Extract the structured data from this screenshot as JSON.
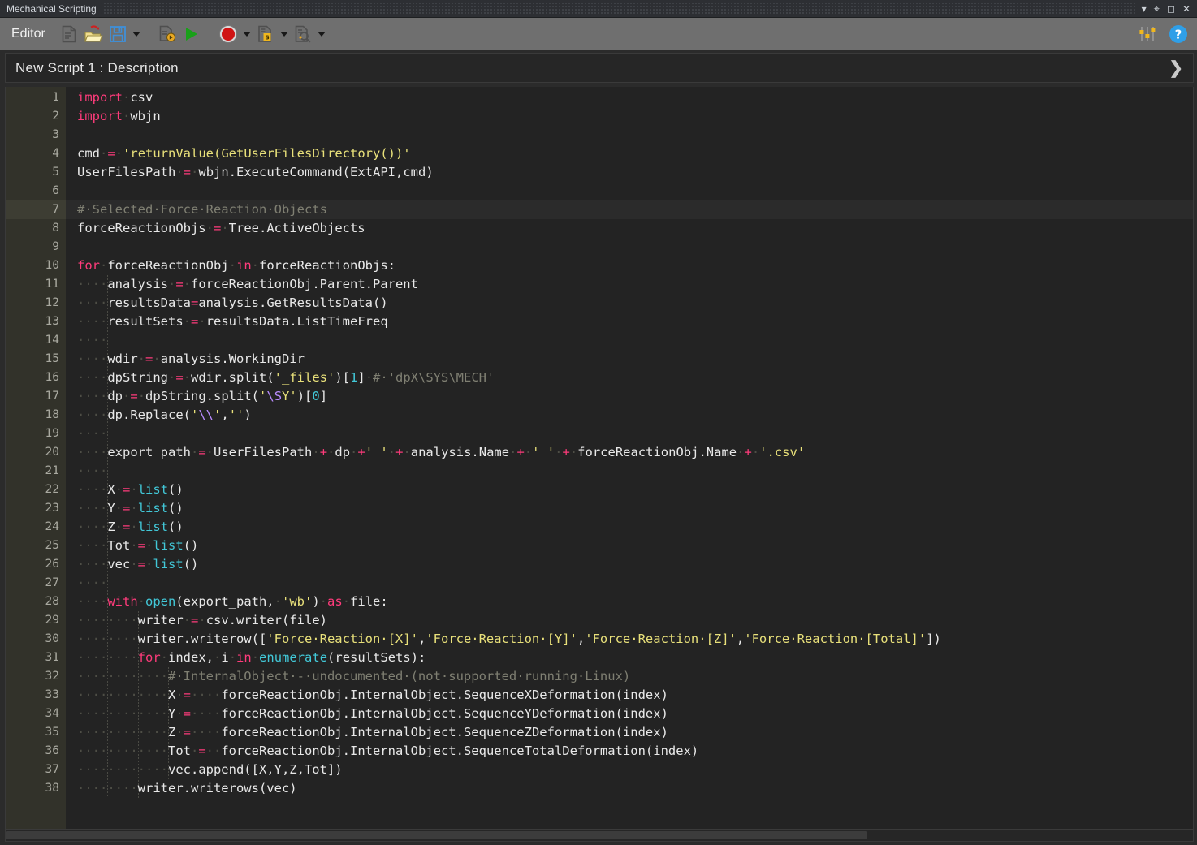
{
  "window": {
    "title": "Mechanical Scripting",
    "buttons": [
      {
        "name": "titlebar-dropdown-icon",
        "glyph": "▾"
      },
      {
        "name": "pin-icon",
        "glyph": "⇟"
      },
      {
        "name": "maximize-icon",
        "glyph": "◻"
      },
      {
        "name": "close-icon",
        "glyph": "✕"
      }
    ]
  },
  "toolbar": {
    "label": "Editor",
    "items": [
      {
        "name": "new-script-button",
        "icon": "new-file-icon",
        "tooltip": "New Script"
      },
      {
        "name": "open-script-button",
        "icon": "open-folder-icon",
        "tooltip": "Open Script"
      },
      {
        "name": "save-script-button",
        "icon": "save-disk-icon",
        "tooltip": "Save Script"
      },
      {
        "name": "save-dropdown-button",
        "icon": "chevron-down-icon",
        "tooltip": "Save options"
      },
      {
        "name": "debug-run-button",
        "icon": "debug-script-icon",
        "tooltip": "Debug"
      },
      {
        "name": "run-script-button",
        "icon": "play-triangle-icon",
        "tooltip": "Run Script"
      },
      {
        "name": "record-button",
        "icon": "record-circle-icon",
        "tooltip": "Record"
      },
      {
        "name": "record-dropdown-button",
        "icon": "chevron-down-icon",
        "tooltip": "Record options"
      },
      {
        "name": "snippet-button",
        "icon": "snippet-s-icon",
        "tooltip": "Snippets"
      },
      {
        "name": "snippet-dropdown-button",
        "icon": "chevron-down-icon",
        "tooltip": "Snippet options"
      },
      {
        "name": "find-script-button",
        "icon": "search-document-icon",
        "tooltip": "Find"
      },
      {
        "name": "find-dropdown-button",
        "icon": "chevron-down-icon",
        "tooltip": "Find options"
      }
    ],
    "right_items": [
      {
        "name": "settings-sliders-button",
        "icon": "sliders-icon"
      },
      {
        "name": "help-button",
        "icon": "help-circle-icon"
      }
    ]
  },
  "script_header": {
    "name": "New Script 1  : Description",
    "expand_glyph": "❯"
  },
  "editor": {
    "first_line": 1,
    "total_lines": 38,
    "highlighted_line": 7,
    "fold_lines": [
      10,
      28,
      31
    ],
    "lines": [
      {
        "n": 1,
        "tokens": [
          [
            "kw",
            "import"
          ],
          [
            "ws",
            "·"
          ],
          [
            "pl",
            "csv"
          ]
        ]
      },
      {
        "n": 2,
        "tokens": [
          [
            "kw",
            "import"
          ],
          [
            "ws",
            "·"
          ],
          [
            "pl",
            "wbjn"
          ]
        ]
      },
      {
        "n": 3,
        "tokens": []
      },
      {
        "n": 4,
        "tokens": [
          [
            "pl",
            "cmd"
          ],
          [
            "ws",
            "·"
          ],
          [
            "op",
            "="
          ],
          [
            "ws",
            "·"
          ],
          [
            "str",
            "'returnValue(GetUserFilesDirectory())'"
          ]
        ]
      },
      {
        "n": 5,
        "tokens": [
          [
            "pl",
            "UserFilesPath"
          ],
          [
            "ws",
            "·"
          ],
          [
            "op",
            "="
          ],
          [
            "ws",
            "·"
          ],
          [
            "pl",
            "wbjn.ExecuteCommand(ExtAPI,cmd)"
          ]
        ]
      },
      {
        "n": 6,
        "tokens": []
      },
      {
        "n": 7,
        "tokens": [
          [
            "cmt",
            "#·Selected·Force·Reaction·Objects"
          ]
        ]
      },
      {
        "n": 8,
        "tokens": [
          [
            "pl",
            "forceReactionObjs"
          ],
          [
            "ws",
            "·"
          ],
          [
            "op",
            "="
          ],
          [
            "ws",
            "·"
          ],
          [
            "pl",
            "Tree.ActiveObjects"
          ]
        ]
      },
      {
        "n": 9,
        "tokens": []
      },
      {
        "n": 10,
        "tokens": [
          [
            "kw",
            "for"
          ],
          [
            "ws",
            "·"
          ],
          [
            "pl",
            "forceReactionObj"
          ],
          [
            "ws",
            "·"
          ],
          [
            "kw",
            "in"
          ],
          [
            "ws",
            "·"
          ],
          [
            "pl",
            "forceReactionObjs:"
          ]
        ]
      },
      {
        "n": 11,
        "tokens": [
          [
            "ws",
            "····"
          ],
          [
            "pl",
            "analysis"
          ],
          [
            "ws",
            "·"
          ],
          [
            "op",
            "="
          ],
          [
            "ws",
            "·"
          ],
          [
            "pl",
            "forceReactionObj.Parent.Parent"
          ]
        ]
      },
      {
        "n": 12,
        "tokens": [
          [
            "ws",
            "····"
          ],
          [
            "pl",
            "resultsData"
          ],
          [
            "op",
            "="
          ],
          [
            "pl",
            "analysis.GetResultsData()"
          ]
        ]
      },
      {
        "n": 13,
        "tokens": [
          [
            "ws",
            "····"
          ],
          [
            "pl",
            "resultSets"
          ],
          [
            "ws",
            "·"
          ],
          [
            "op",
            "="
          ],
          [
            "ws",
            "·"
          ],
          [
            "pl",
            "resultsData.ListTimeFreq"
          ]
        ]
      },
      {
        "n": 14,
        "tokens": [
          [
            "ws",
            "····"
          ]
        ]
      },
      {
        "n": 15,
        "tokens": [
          [
            "ws",
            "····"
          ],
          [
            "pl",
            "wdir"
          ],
          [
            "ws",
            "·"
          ],
          [
            "op",
            "="
          ],
          [
            "ws",
            "·"
          ],
          [
            "pl",
            "analysis.WorkingDir"
          ]
        ]
      },
      {
        "n": 16,
        "tokens": [
          [
            "ws",
            "····"
          ],
          [
            "pl",
            "dpString"
          ],
          [
            "ws",
            "·"
          ],
          [
            "op",
            "="
          ],
          [
            "ws",
            "·"
          ],
          [
            "pl",
            "wdir.split("
          ],
          [
            "str",
            "'_files'"
          ],
          [
            "pl",
            ")["
          ],
          [
            "num",
            "1"
          ],
          [
            "pl",
            "]"
          ],
          [
            "ws",
            "·"
          ],
          [
            "cmt",
            "#·'dpX\\SYS\\MECH'"
          ]
        ]
      },
      {
        "n": 17,
        "tokens": [
          [
            "ws",
            "····"
          ],
          [
            "pl",
            "dp"
          ],
          [
            "ws",
            "·"
          ],
          [
            "op",
            "="
          ],
          [
            "ws",
            "·"
          ],
          [
            "pl",
            "dpString.split("
          ],
          [
            "str",
            "'"
          ],
          [
            "esc",
            "\\S"
          ],
          [
            "str",
            "Y'"
          ],
          [
            "pl",
            ")["
          ],
          [
            "num",
            "0"
          ],
          [
            "pl",
            "]"
          ]
        ]
      },
      {
        "n": 18,
        "tokens": [
          [
            "ws",
            "····"
          ],
          [
            "pl",
            "dp.Replace("
          ],
          [
            "str",
            "'"
          ],
          [
            "esc",
            "\\\\"
          ],
          [
            "str",
            "'"
          ],
          [
            "pl",
            ","
          ],
          [
            "str",
            "''"
          ],
          [
            "pl",
            ")"
          ]
        ]
      },
      {
        "n": 19,
        "tokens": [
          [
            "ws",
            "····"
          ]
        ]
      },
      {
        "n": 20,
        "tokens": [
          [
            "ws",
            "····"
          ],
          [
            "pl",
            "export_path"
          ],
          [
            "ws",
            "·"
          ],
          [
            "op",
            "="
          ],
          [
            "ws",
            "·"
          ],
          [
            "pl",
            "UserFilesPath"
          ],
          [
            "ws",
            "·"
          ],
          [
            "op",
            "+"
          ],
          [
            "ws",
            "·"
          ],
          [
            "pl",
            "dp"
          ],
          [
            "ws",
            "·"
          ],
          [
            "op",
            "+"
          ],
          [
            "str",
            "'_'"
          ],
          [
            "ws",
            "·"
          ],
          [
            "op",
            "+"
          ],
          [
            "ws",
            "·"
          ],
          [
            "pl",
            "analysis.Name"
          ],
          [
            "ws",
            "·"
          ],
          [
            "op",
            "+"
          ],
          [
            "ws",
            "·"
          ],
          [
            "str",
            "'_'"
          ],
          [
            "ws",
            "·"
          ],
          [
            "op",
            "+"
          ],
          [
            "ws",
            "·"
          ],
          [
            "pl",
            "forceReactionObj.Name"
          ],
          [
            "ws",
            "·"
          ],
          [
            "op",
            "+"
          ],
          [
            "ws",
            "·"
          ],
          [
            "str",
            "'.csv'"
          ]
        ]
      },
      {
        "n": 21,
        "tokens": [
          [
            "ws",
            "····"
          ]
        ]
      },
      {
        "n": 22,
        "tokens": [
          [
            "ws",
            "····"
          ],
          [
            "pl",
            "X"
          ],
          [
            "ws",
            "·"
          ],
          [
            "op",
            "="
          ],
          [
            "ws",
            "·"
          ],
          [
            "bi",
            "list"
          ],
          [
            "pl",
            "()"
          ]
        ]
      },
      {
        "n": 23,
        "tokens": [
          [
            "ws",
            "····"
          ],
          [
            "pl",
            "Y"
          ],
          [
            "ws",
            "·"
          ],
          [
            "op",
            "="
          ],
          [
            "ws",
            "·"
          ],
          [
            "bi",
            "list"
          ],
          [
            "pl",
            "()"
          ]
        ]
      },
      {
        "n": 24,
        "tokens": [
          [
            "ws",
            "····"
          ],
          [
            "pl",
            "Z"
          ],
          [
            "ws",
            "·"
          ],
          [
            "op",
            "="
          ],
          [
            "ws",
            "·"
          ],
          [
            "bi",
            "list"
          ],
          [
            "pl",
            "()"
          ]
        ]
      },
      {
        "n": 25,
        "tokens": [
          [
            "ws",
            "····"
          ],
          [
            "pl",
            "Tot"
          ],
          [
            "ws",
            "·"
          ],
          [
            "op",
            "="
          ],
          [
            "ws",
            "·"
          ],
          [
            "bi",
            "list"
          ],
          [
            "pl",
            "()"
          ]
        ]
      },
      {
        "n": 26,
        "tokens": [
          [
            "ws",
            "····"
          ],
          [
            "pl",
            "vec"
          ],
          [
            "ws",
            "·"
          ],
          [
            "op",
            "="
          ],
          [
            "ws",
            "·"
          ],
          [
            "bi",
            "list"
          ],
          [
            "pl",
            "()"
          ]
        ]
      },
      {
        "n": 27,
        "tokens": [
          [
            "ws",
            "····"
          ]
        ]
      },
      {
        "n": 28,
        "tokens": [
          [
            "ws",
            "····"
          ],
          [
            "kw",
            "with"
          ],
          [
            "ws",
            "·"
          ],
          [
            "bi",
            "open"
          ],
          [
            "pl",
            "(export_path,"
          ],
          [
            "ws",
            "·"
          ],
          [
            "str",
            "'wb'"
          ],
          [
            "pl",
            ")"
          ],
          [
            "ws",
            "·"
          ],
          [
            "kw",
            "as"
          ],
          [
            "ws",
            "·"
          ],
          [
            "pl",
            "file:"
          ]
        ]
      },
      {
        "n": 29,
        "tokens": [
          [
            "ws",
            "········"
          ],
          [
            "pl",
            "writer"
          ],
          [
            "ws",
            "·"
          ],
          [
            "op",
            "="
          ],
          [
            "ws",
            "·"
          ],
          [
            "pl",
            "csv.writer(file)"
          ]
        ]
      },
      {
        "n": 30,
        "tokens": [
          [
            "ws",
            "········"
          ],
          [
            "pl",
            "writer.writerow(["
          ],
          [
            "str",
            "'Force·Reaction·[X]'"
          ],
          [
            "pl",
            ","
          ],
          [
            "str",
            "'Force·Reaction·[Y]'"
          ],
          [
            "pl",
            ","
          ],
          [
            "str",
            "'Force·Reaction·[Z]'"
          ],
          [
            "pl",
            ","
          ],
          [
            "str",
            "'Force·Reaction·[Total]'"
          ],
          [
            "pl",
            "])"
          ]
        ]
      },
      {
        "n": 31,
        "tokens": [
          [
            "ws",
            "········"
          ],
          [
            "kw",
            "for"
          ],
          [
            "ws",
            "·"
          ],
          [
            "pl",
            "index,"
          ],
          [
            "ws",
            "·"
          ],
          [
            "pl",
            "i"
          ],
          [
            "ws",
            "·"
          ],
          [
            "kw",
            "in"
          ],
          [
            "ws",
            "·"
          ],
          [
            "bi",
            "enumerate"
          ],
          [
            "pl",
            "(resultSets):"
          ]
        ]
      },
      {
        "n": 32,
        "tokens": [
          [
            "ws",
            "············"
          ],
          [
            "cmt",
            "#·InternalObject·-·undocumented·(not·supported·running·Linux)"
          ]
        ]
      },
      {
        "n": 33,
        "tokens": [
          [
            "ws",
            "············"
          ],
          [
            "pl",
            "X"
          ],
          [
            "ws",
            "·"
          ],
          [
            "op",
            "="
          ],
          [
            "ws",
            "····"
          ],
          [
            "pl",
            "forceReactionObj.InternalObject.SequenceXDeformation(index)"
          ]
        ]
      },
      {
        "n": 34,
        "tokens": [
          [
            "ws",
            "············"
          ],
          [
            "pl",
            "Y"
          ],
          [
            "ws",
            "·"
          ],
          [
            "op",
            "="
          ],
          [
            "ws",
            "····"
          ],
          [
            "pl",
            "forceReactionObj.InternalObject.SequenceYDeformation(index)"
          ]
        ]
      },
      {
        "n": 35,
        "tokens": [
          [
            "ws",
            "············"
          ],
          [
            "pl",
            "Z"
          ],
          [
            "ws",
            "·"
          ],
          [
            "op",
            "="
          ],
          [
            "ws",
            "····"
          ],
          [
            "pl",
            "forceReactionObj.InternalObject.SequenceZDeformation(index)"
          ]
        ]
      },
      {
        "n": 36,
        "tokens": [
          [
            "ws",
            "············"
          ],
          [
            "pl",
            "Tot"
          ],
          [
            "ws",
            "·"
          ],
          [
            "op",
            "="
          ],
          [
            "ws",
            "··"
          ],
          [
            "pl",
            "forceReactionObj.InternalObject.SequenceTotalDeformation(index)"
          ]
        ]
      },
      {
        "n": 37,
        "tokens": [
          [
            "ws",
            "············"
          ],
          [
            "pl",
            "vec.append([X,Y,Z,Tot])"
          ]
        ]
      },
      {
        "n": 38,
        "tokens": [
          [
            "ws",
            "········"
          ],
          [
            "pl",
            "writer.writerows(vec)"
          ]
        ]
      }
    ]
  },
  "colors": {
    "editor_background": "#232323",
    "gutter_background": "#32322a",
    "toolbar_background": "#6f6f6f",
    "titlebar_background": "#2d2f33",
    "keyword": "#ff3b7b",
    "builtin": "#42c8d8",
    "string": "#e8e07a",
    "comment": "#7f7f72",
    "escape": "#b98cff",
    "plain": "#e8e8e8",
    "whitespace_dot": "#4e4e46"
  }
}
